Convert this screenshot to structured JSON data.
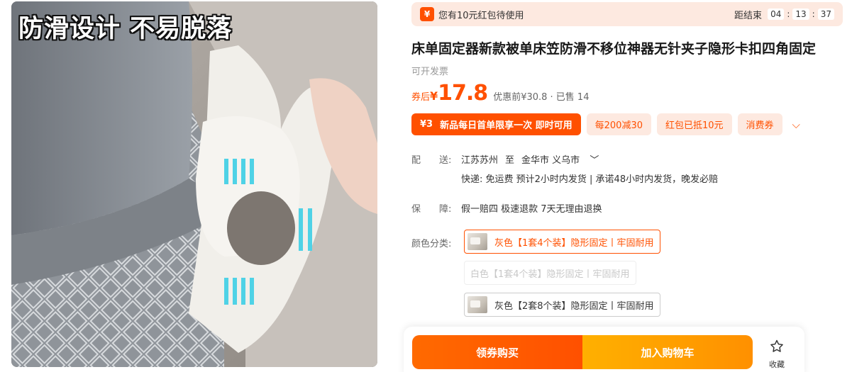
{
  "image": {
    "caption": "防滑设计 不易脱落"
  },
  "coupon_bar": {
    "icon": "¥",
    "text": "您有10元红包待使用",
    "countdown_label": "距结束",
    "hours": "04",
    "minutes": "13",
    "seconds": "37",
    "sep": ":"
  },
  "product": {
    "title": "床单固定器新款被单床笠防滑不移位神器无针夹子隐形卡扣四角固定",
    "invoice": "可开发票",
    "price_label": "券后",
    "price_symbol": "¥",
    "price_value": "17.8",
    "price_before": "优惠前¥30.8 · 已售 14"
  },
  "promos": {
    "main_amount": "¥3",
    "main_text": "新品每日首单限享一次 即时可用",
    "tags": [
      "每200减30",
      "红包已抵10元",
      "消费券"
    ],
    "more_icon": "chevron-down-icon",
    "more_glyph": "⌵"
  },
  "delivery": {
    "label": "配　　送:",
    "from": "江苏苏州",
    "to_word": "至",
    "to": "金华市 义乌市",
    "to_chevron": "﹀",
    "detail": "快递: 免运费  预计2小时内发货 | 承诺48小时内发货，晚发必赔"
  },
  "guarantee": {
    "label": "保　　障:",
    "value": "假一赔四 极速退款 7天无理由退换"
  },
  "color": {
    "label": "颜色分类:",
    "options": [
      {
        "text": "灰色【1套4个装】隐形固定丨牢固耐用",
        "state": "selected"
      },
      {
        "text": "白色【1套4个装】隐形固定丨牢固耐用",
        "state": "disabled"
      },
      {
        "text": "灰色【2套8个装】隐形固定丨牢固耐用",
        "state": "normal"
      }
    ]
  },
  "actions": {
    "buy": "领券购买",
    "cart": "加入购物车",
    "favorite": "收藏"
  },
  "colors": {
    "accent": "#ff5000",
    "cart_button": "#ffa000",
    "coupon_bg": "#fde9e0"
  }
}
